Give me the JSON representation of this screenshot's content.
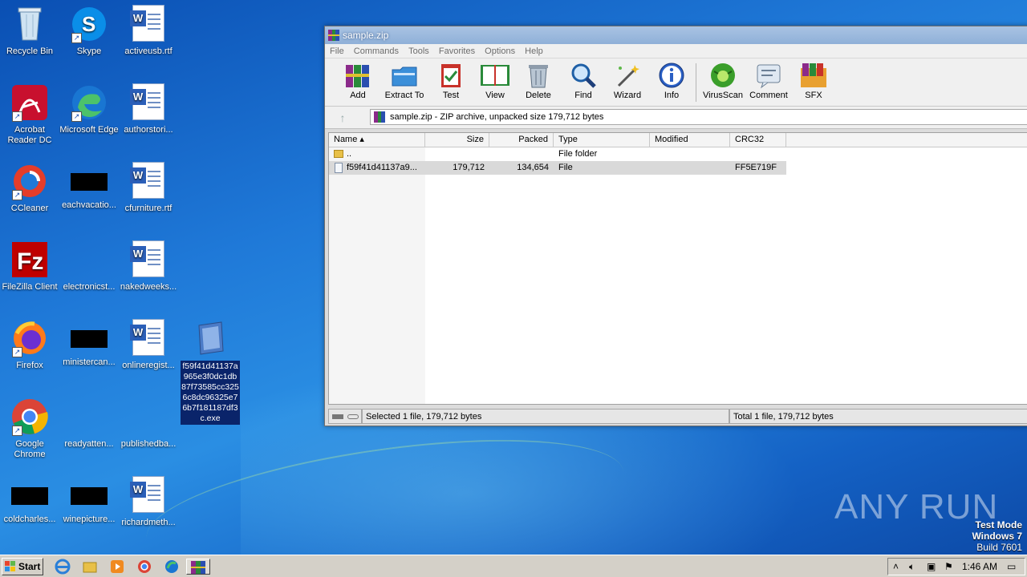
{
  "desktop": {
    "icons": [
      {
        "label": "Recycle Bin"
      },
      {
        "label": "Skype"
      },
      {
        "label": "activeusb.rtf"
      },
      {
        "label": "Acrobat Reader DC"
      },
      {
        "label": "Microsoft Edge"
      },
      {
        "label": "authorstori..."
      },
      {
        "label": "CCleaner"
      },
      {
        "label": "eachvacatio..."
      },
      {
        "label": "cfurniture.rtf"
      },
      {
        "label": "FileZilla Client"
      },
      {
        "label": "electronicst..."
      },
      {
        "label": "nakedweeks..."
      },
      {
        "label": "Firefox"
      },
      {
        "label": "ministercan..."
      },
      {
        "label": "onlineregist..."
      },
      {
        "label": "Google Chrome"
      },
      {
        "label": "readyatten..."
      },
      {
        "label": "publishedba..."
      },
      {
        "label": "coldcharles..."
      },
      {
        "label": "winepicture..."
      },
      {
        "label": "richardmeth..."
      }
    ],
    "selected_file_label": "f59f41d41137a965e3f0dc1db87f73585cc3256c8dc96325e76b7f181187df3c.exe"
  },
  "window": {
    "title": "sample.zip",
    "menu": [
      "File",
      "Commands",
      "Tools",
      "Favorites",
      "Options",
      "Help"
    ],
    "toolbar": [
      "Add",
      "Extract To",
      "Test",
      "View",
      "Delete",
      "Find",
      "Wizard",
      "Info",
      "VirusScan",
      "Comment",
      "SFX"
    ],
    "address": "sample.zip - ZIP archive, unpacked size 179,712 bytes",
    "columns": [
      "Name",
      "Size",
      "Packed",
      "Type",
      "Modified",
      "CRC32"
    ],
    "rows": [
      {
        "name": "..",
        "size": "",
        "packed": "",
        "type": "File folder",
        "modified": "",
        "crc": ""
      },
      {
        "name": "f59f41d41137a9...",
        "size": "179,712",
        "packed": "134,654",
        "type": "File",
        "modified": "",
        "crc": "FF5E719F"
      }
    ],
    "status_left": "Selected 1 file, 179,712 bytes",
    "status_right": "Total 1 file, 179,712 bytes"
  },
  "watermark": {
    "brand": "ANY RUN",
    "testmode_line1": "Test Mode",
    "testmode_line2": "Windows 7",
    "testmode_line3": "Build 7601"
  },
  "taskbar": {
    "start_label": "Start",
    "clock": "1:46 AM"
  }
}
